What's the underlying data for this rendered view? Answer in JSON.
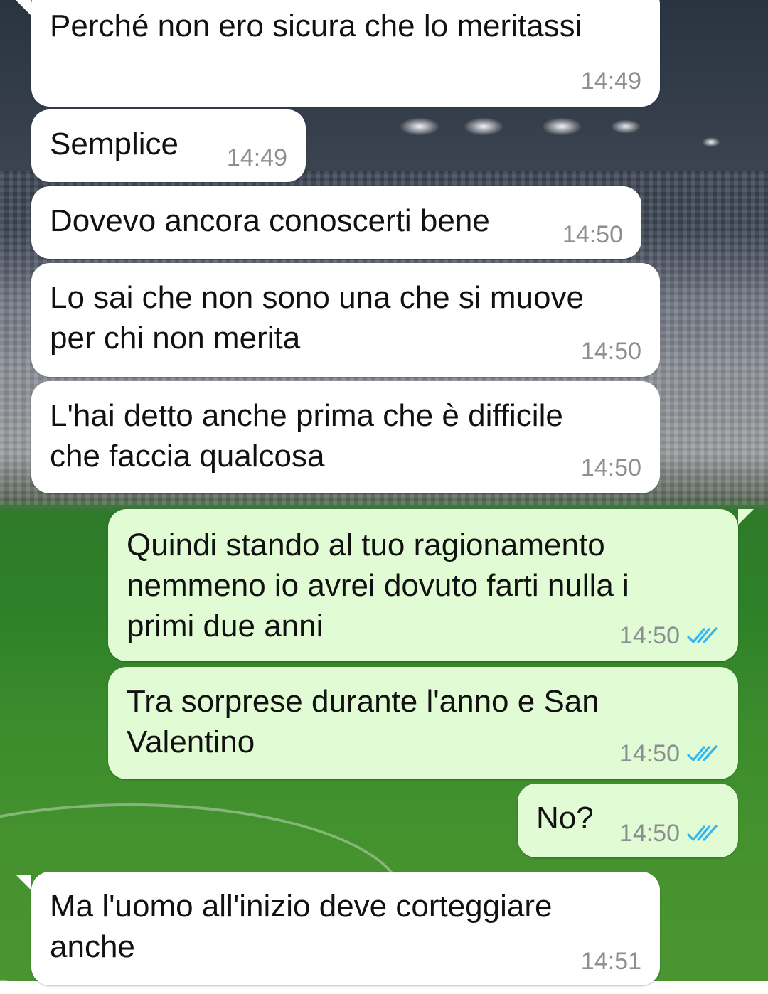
{
  "chat": {
    "messages": [
      {
        "text": "Perché non ero sicura che lo meritassi",
        "time": "14:49",
        "direction": "incoming"
      },
      {
        "text": "Semplice",
        "time": "14:49",
        "direction": "incoming"
      },
      {
        "text": "Dovevo ancora conoscerti bene",
        "time": "14:50",
        "direction": "incoming"
      },
      {
        "lines": [
          "Lo sai che non sono una che si muove",
          "per chi non merita"
        ],
        "time": "14:50",
        "direction": "incoming"
      },
      {
        "lines": [
          "L'hai detto anche prima che è difficile",
          "che faccia qualcosa"
        ],
        "time": "14:50",
        "direction": "incoming"
      },
      {
        "lines": [
          "Quindi stando al tuo ragionamento",
          "nemmeno io avrei dovuto farti nulla i",
          "primi due anni"
        ],
        "time": "14:50",
        "direction": "outgoing",
        "status": "read"
      },
      {
        "lines": [
          "Tra sorprese durante l'anno e San",
          "Valentino"
        ],
        "time": "14:50",
        "direction": "outgoing",
        "status": "read"
      },
      {
        "text": "No?",
        "time": "14:50",
        "direction": "outgoing",
        "status": "read"
      },
      {
        "lines": [
          "Ma l'uomo all'inizio deve corteggiare",
          "anche"
        ],
        "time": "14:51",
        "direction": "incoming"
      }
    ]
  },
  "colors": {
    "incoming_bubble": "#ffffff",
    "outgoing_bubble": "#e1fbd4",
    "read_tick": "#34b7f1",
    "timestamp": "#8a8f92"
  },
  "icons": {
    "read_receipt": "double-check-icon"
  }
}
